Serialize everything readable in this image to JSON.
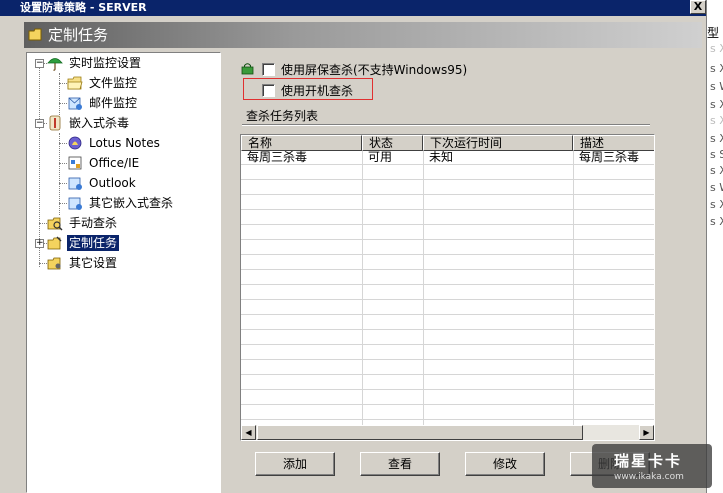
{
  "window": {
    "title": "设置防毒策略 - SERVER",
    "close_label": "X"
  },
  "banner": {
    "title": "定制任务"
  },
  "tree": {
    "items": [
      {
        "label": "实时监控设置",
        "icon": "umbrella-icon"
      },
      {
        "label": "文件监控",
        "icon": "folder-icon"
      },
      {
        "label": "邮件监控",
        "icon": "mail-monitor-icon"
      },
      {
        "label": "嵌入式杀毒",
        "icon": "embedded-scan-icon"
      },
      {
        "label": "Lotus Notes",
        "icon": "lotus-icon"
      },
      {
        "label": "Office/IE",
        "icon": "office-icon"
      },
      {
        "label": "Outlook",
        "icon": "outlook-icon"
      },
      {
        "label": "其它嵌入式查杀",
        "icon": "other-embedded-icon"
      },
      {
        "label": "手动查杀",
        "icon": "manual-scan-icon"
      },
      {
        "label": "定制任务",
        "icon": "custom-task-icon",
        "selected": true
      },
      {
        "label": "其它设置",
        "icon": "other-settings-icon"
      }
    ]
  },
  "options": {
    "screensaver_scan": "使用屏保查杀(不支持Windows95)",
    "startup_scan": "使用开机查杀"
  },
  "task_list": {
    "label": "查杀任务列表",
    "columns": [
      "名称",
      "状态",
      "下次运行时间",
      "描述"
    ],
    "rows": [
      [
        "每周三杀毒",
        "可用",
        "未知",
        "每周三杀毒"
      ]
    ]
  },
  "buttons": {
    "add": "添加",
    "view": "查看",
    "modify": "修改",
    "delete": "删除"
  },
  "background_window": {
    "header": "型",
    "cells": [
      "s X",
      "s X",
      "s W",
      "s X",
      "s X",
      "s X",
      "s S",
      "s X",
      "s W",
      "s X",
      "s X"
    ]
  },
  "watermark": {
    "line1": "瑞星卡卡",
    "line2": "www.ikaka.com"
  },
  "colors": {
    "titlebar": "#0a246a",
    "selection": "#0a246a",
    "highlight_box": "#e03030"
  }
}
